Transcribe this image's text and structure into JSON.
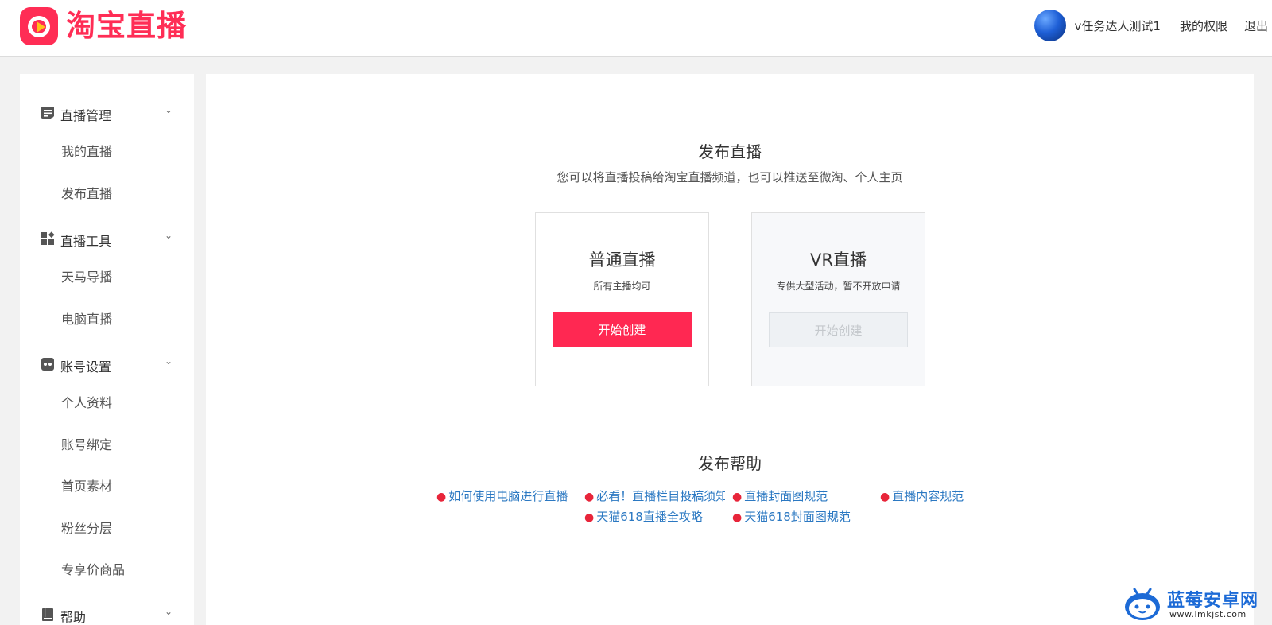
{
  "header": {
    "logo_text": "淘宝直播",
    "user_name": "v任务达人测试1",
    "permissions_link": "我的权限",
    "logout_link": "退出"
  },
  "sidebar": {
    "groups": [
      {
        "label": "直播管理",
        "icon": "document-icon",
        "items": [
          "我的直播",
          "发布直播"
        ]
      },
      {
        "label": "直播工具",
        "icon": "tools-grid-icon",
        "items": [
          "天马导播",
          "电脑直播"
        ]
      },
      {
        "label": "账号设置",
        "icon": "account-icon",
        "items": [
          "个人资料",
          "账号绑定",
          "首页素材",
          "粉丝分层",
          "专享价商品"
        ]
      },
      {
        "label": "帮助",
        "icon": "book-icon",
        "items": []
      }
    ]
  },
  "main": {
    "title": "发布直播",
    "subtitle": "您可以将直播投稿给淘宝直播频道，也可以推送至微淘、个人主页",
    "cards": [
      {
        "title": "普通直播",
        "desc": "所有主播均可",
        "button": "开始创建",
        "enabled": true
      },
      {
        "title": "VR直播",
        "desc": "专供大型活动，暂不开放申请",
        "button": "开始创建",
        "enabled": false
      }
    ],
    "help_title": "发布帮助",
    "help_links": [
      "如何使用电脑进行直播",
      "必看！直播栏目投稿须知",
      "直播封面图规范",
      "直播内容规范",
      "天猫618直播全攻略",
      "天猫618封面图规范"
    ]
  },
  "watermark": {
    "title": "蓝莓安卓网",
    "url": "www.lmkjst.com"
  },
  "colors": {
    "brand": "#ff2d55",
    "primary_button": "#ff2852",
    "link": "#2b78c2",
    "bullet": "#e8253a",
    "watermark": "#1c6ad6"
  }
}
